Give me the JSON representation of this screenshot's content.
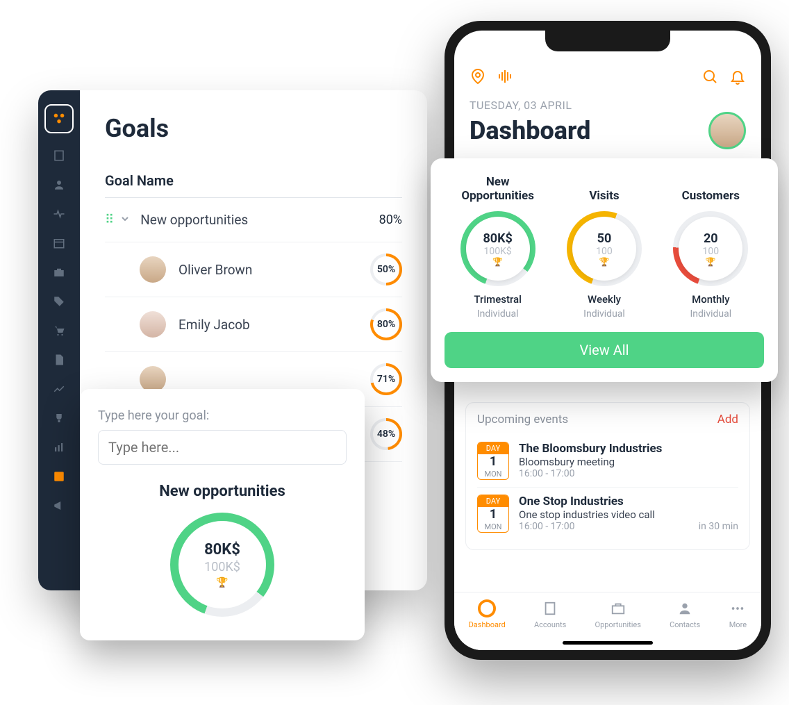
{
  "desktop": {
    "title": "Goals",
    "header": "Goal Name",
    "parent": {
      "name": "New opportunities",
      "pct": "80%"
    },
    "rows": [
      {
        "name": "Oliver Brown",
        "pct": "50%",
        "pctVal": 50
      },
      {
        "name": "Emily Jacob",
        "pct": "80%",
        "pctVal": 80
      },
      {
        "name": "",
        "pct": "71%",
        "pctVal": 71
      },
      {
        "name": "",
        "pct": "48%",
        "pctVal": 48
      }
    ]
  },
  "popup": {
    "label": "Type here your goal:",
    "placeholder": "Type here...",
    "title": "New opportunities",
    "value": "80K$",
    "target": "100K$"
  },
  "phone": {
    "date": "TUESDAY, 03 APRIL",
    "title": "Dashboard",
    "events_title": "Upcoming events",
    "add": "Add",
    "events": [
      {
        "day_label": "DAY",
        "day_num": "1",
        "day_dow": "MON",
        "title": "The Bloomsbury Industries",
        "sub": "Bloomsbury meeting",
        "time": "16:00 - 17:00",
        "meta": ""
      },
      {
        "day_label": "DAY",
        "day_num": "1",
        "day_dow": "MON",
        "title": "One Stop Industries",
        "sub": "One stop industries video call",
        "time": "16:00 - 17:00",
        "meta": "in 30 min"
      }
    ],
    "tabs": [
      {
        "label": "Dashboard"
      },
      {
        "label": "Accounts"
      },
      {
        "label": "Opportunities"
      },
      {
        "label": "Contacts"
      },
      {
        "label": "More"
      }
    ]
  },
  "kpi": {
    "items": [
      {
        "name": "New Opportunities",
        "value": "80K$",
        "target": "100K$",
        "period": "Trimestral",
        "type": "Individual",
        "color": "#4fd386",
        "pct": 80
      },
      {
        "name": "Visits",
        "value": "50",
        "target": "100",
        "period": "Weekly",
        "type": "Individual",
        "color": "#f5b400",
        "pct": 50
      },
      {
        "name": "Customers",
        "value": "20",
        "target": "100",
        "period": "Monthly",
        "type": "Individual",
        "color": "#e74c3c",
        "pct": 20
      }
    ],
    "view_all": "View All"
  },
  "chart_data": [
    {
      "type": "pie",
      "title": "New opportunities (goal popup)",
      "values": [
        80,
        20
      ],
      "value_label": "80K$",
      "target_label": "100K$",
      "color": "#4fd386"
    },
    {
      "type": "pie",
      "title": "New Opportunities KPI",
      "values": [
        80,
        20
      ],
      "value_label": "80K$",
      "target_label": "100K$",
      "period": "Trimestral",
      "scope": "Individual",
      "color": "#4fd386"
    },
    {
      "type": "pie",
      "title": "Visits KPI",
      "values": [
        50,
        50
      ],
      "value_label": "50",
      "target_label": "100",
      "period": "Weekly",
      "scope": "Individual",
      "color": "#f5b400"
    },
    {
      "type": "pie",
      "title": "Customers KPI",
      "values": [
        20,
        80
      ],
      "value_label": "20",
      "target_label": "100",
      "period": "Monthly",
      "scope": "Individual",
      "color": "#e74c3c"
    },
    {
      "type": "pie",
      "title": "Oliver Brown progress",
      "values": [
        50,
        50
      ],
      "color": "#ff8c00"
    },
    {
      "type": "pie",
      "title": "Emily Jacob progress",
      "values": [
        80,
        20
      ],
      "color": "#ff8c00"
    }
  ]
}
